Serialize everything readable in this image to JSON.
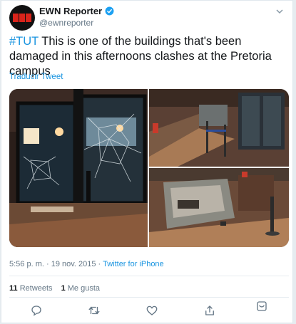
{
  "author": {
    "name": "EWN Reporter",
    "handle": "@ewnreporter",
    "verified": true,
    "avatar_icon": "ewn-logo-icon"
  },
  "tweet": {
    "hashtag": "#TUT",
    "text": " This is one of the buildings that's been damaged in this afternoons clashes at the Pretoria campus",
    "translate_label": "Traducir Tweet"
  },
  "media": {
    "photos": [
      "shattered-glass-door-photo",
      "damaged-cafeteria-counter-photo",
      "overturned-display-fridge-photo"
    ]
  },
  "meta": {
    "time": "5:56 p. m.",
    "separator": " · ",
    "date": "19 nov. 2015",
    "source": "Twitter for iPhone"
  },
  "stats": {
    "retweets_count": "11",
    "retweets_label": "Retweets",
    "likes_count": "1",
    "likes_label": "Me gusta"
  },
  "actions": [
    "reply-icon",
    "retweet-icon",
    "like-icon",
    "share-icon",
    "analytics-icon"
  ],
  "colors": {
    "link": "#1b95e0",
    "text": "#14171a",
    "secondary": "#657786"
  }
}
